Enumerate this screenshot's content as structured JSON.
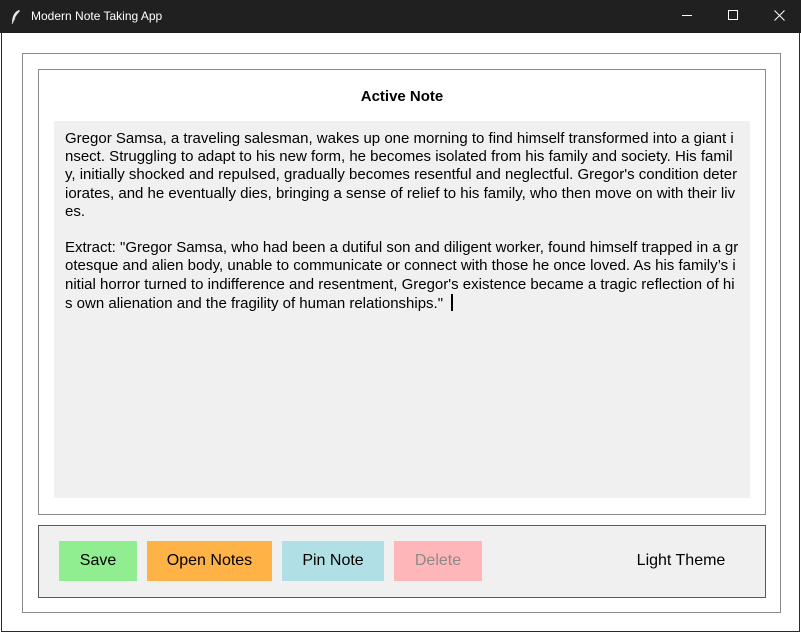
{
  "window": {
    "title": "Modern Note Taking App",
    "icons": {
      "app": "feather-icon",
      "minimize": "minimize-icon",
      "maximize": "maximize-icon",
      "close": "close-icon"
    }
  },
  "note": {
    "heading": "Active Note",
    "content": "Gregor Samsa, a traveling salesman, wakes up one morning to find himself transformed into a giant insect. Struggling to adapt to his new form, he becomes isolated from his family and society. His family, initially shocked and repulsed, gradually becomes resentful and neglectful. Gregor's condition deteriorates, and he eventually dies, bringing a sense of relief to his family, who then move on with their lives.\n\nExtract: \"Gregor Samsa, who had been a dutiful son and diligent worker, found himself trapped in a grotesque and alien body, unable to communicate or connect with those he once loved. As his family’s initial horror turned to indifference and resentment, Gregor's existence became a tragic reflection of his own alienation and the fragility of human relationships.\" "
  },
  "buttons": {
    "save": {
      "label": "Save",
      "color": "#90ee90"
    },
    "open_notes": {
      "label": "Open Notes",
      "color": "#ffb347"
    },
    "pin_note": {
      "label": "Pin Note",
      "color": "#b0e0e6"
    },
    "delete": {
      "label": "Delete",
      "color": "#ffb6b9",
      "text_color": "#8a8a8a"
    },
    "theme": {
      "label": "Light Theme"
    }
  },
  "colors": {
    "titlebar": "#202020",
    "note_background": "#f0f0f0",
    "button_bar_background": "#f0f0f0"
  }
}
